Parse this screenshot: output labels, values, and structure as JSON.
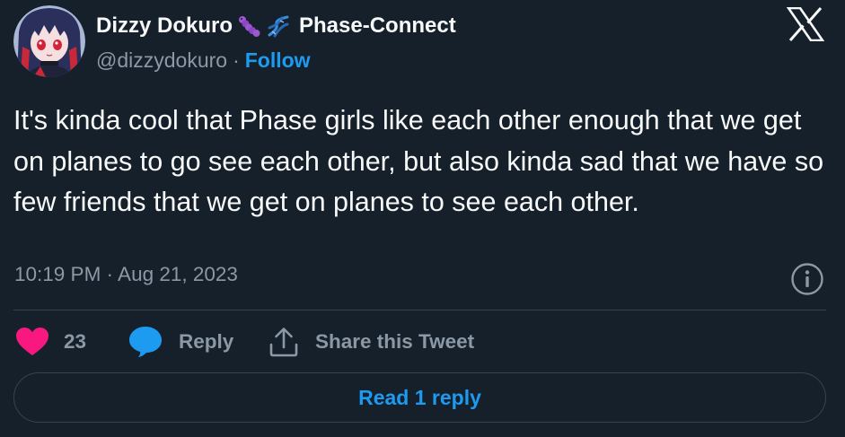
{
  "author": {
    "display_name": "Dizzy Dokuro",
    "badges": [
      "caterpillar-emoji",
      "dna-emoji"
    ],
    "affiliation": "Phase-Connect",
    "handle": "@dizzydokuro",
    "separator": "·",
    "follow_label": "Follow"
  },
  "tweet": {
    "text": "It's kinda cool that Phase girls like each other enough that we get on planes to go see each other, but also kinda sad that we have so few friends that we get on planes to see each other.",
    "timestamp": "10:19 PM · Aug 21, 2023"
  },
  "actions": {
    "like_count": "23",
    "reply_label": "Reply",
    "share_label": "Share this Tweet"
  },
  "footer": {
    "read_reply_label": "Read 1 reply"
  },
  "colors": {
    "background": "#15202b",
    "text_primary": "#f7f9f9",
    "text_secondary": "#8b98a5",
    "accent": "#1d9bf0",
    "like": "#f91880",
    "border": "#38444d"
  },
  "icons": {
    "brand": "x-logo-icon",
    "info": "info-icon",
    "like": "heart-icon",
    "reply": "speech-bubble-icon",
    "share": "share-upload-icon"
  }
}
